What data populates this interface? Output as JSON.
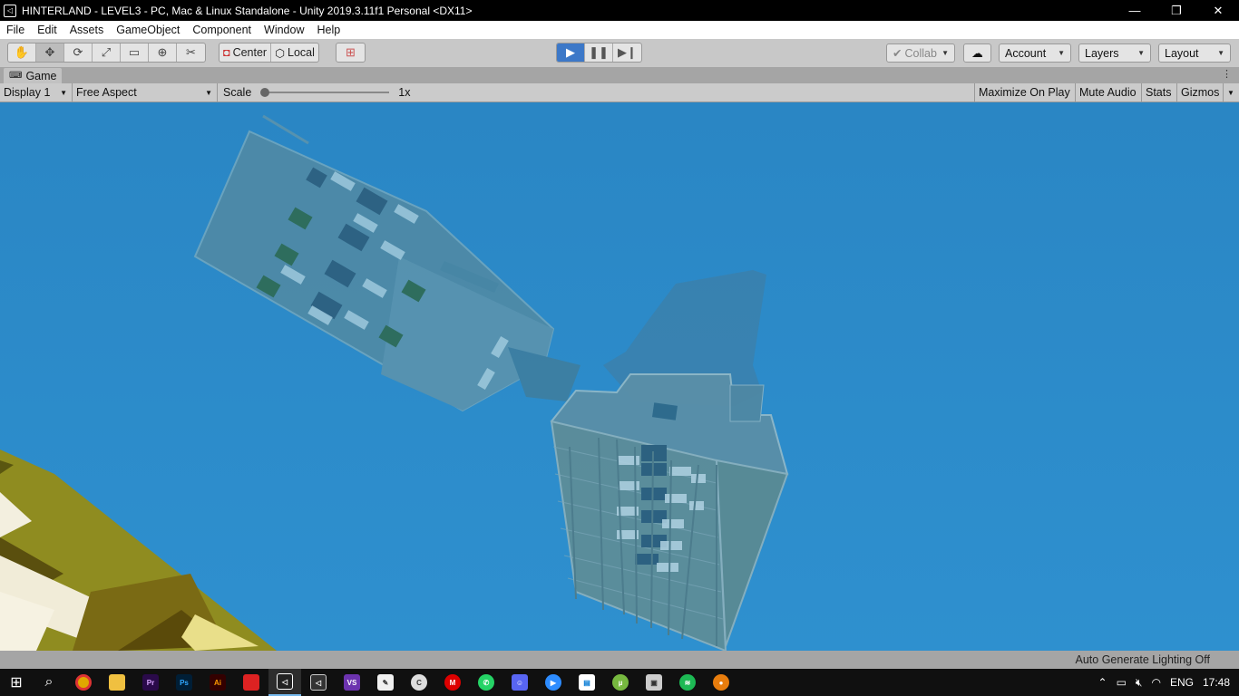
{
  "window": {
    "title": "HINTERLAND - LEVEL3 - PC, Mac & Linux Standalone - Unity 2019.3.11f1 Personal <DX11>",
    "controls": {
      "minimize": "—",
      "restore": "❐",
      "close": "✕"
    }
  },
  "menu": [
    "File",
    "Edit",
    "Assets",
    "GameObject",
    "Component",
    "Window",
    "Help"
  ],
  "toolbar": {
    "tools": [
      "hand-tool",
      "move-tool",
      "rotate-tool",
      "scale-tool",
      "rect-tool",
      "transform-tool",
      "custom-tool"
    ],
    "pivot_center": "Center",
    "pivot_local": "Local",
    "collab": "Collab",
    "account": "Account",
    "layers": "Layers",
    "layout": "Layout",
    "play_state": "playing"
  },
  "game_tab": {
    "label": "Game",
    "display": "Display 1",
    "aspect": "Free Aspect",
    "scale_label": "Scale",
    "scale_value": "1x",
    "scale_slider_fraction": 0,
    "maximize_on_play": "Maximize On Play",
    "mute_audio": "Mute Audio",
    "stats": "Stats",
    "gizmos": "Gizmos"
  },
  "status": {
    "lighting": "Auto Generate Lighting Off"
  },
  "colors": {
    "sky": "#2c8bc9",
    "building": "#5a8fa8",
    "terrain_olive": "#8f8c20",
    "terrain_cream": "#f1ecd8",
    "play_blue": "#3c78c8"
  },
  "taskbar": {
    "apps": [
      "start-icon",
      "search-icon",
      "chrome-icon",
      "file-explorer-icon",
      "premiere-icon",
      "photoshop-icon",
      "illustrator-icon",
      "app-red-icon",
      "unity-icon",
      "unity-hub-icon",
      "visual-studio-icon",
      "paint-icon",
      "ccleaner-icon",
      "mail-icon",
      "whatsapp-icon",
      "discord-icon",
      "zoom-icon",
      "news-icon",
      "utorrent-icon",
      "photos-icon",
      "spotify-icon",
      "blender-icon"
    ],
    "language": "ENG",
    "time": "17:48"
  }
}
